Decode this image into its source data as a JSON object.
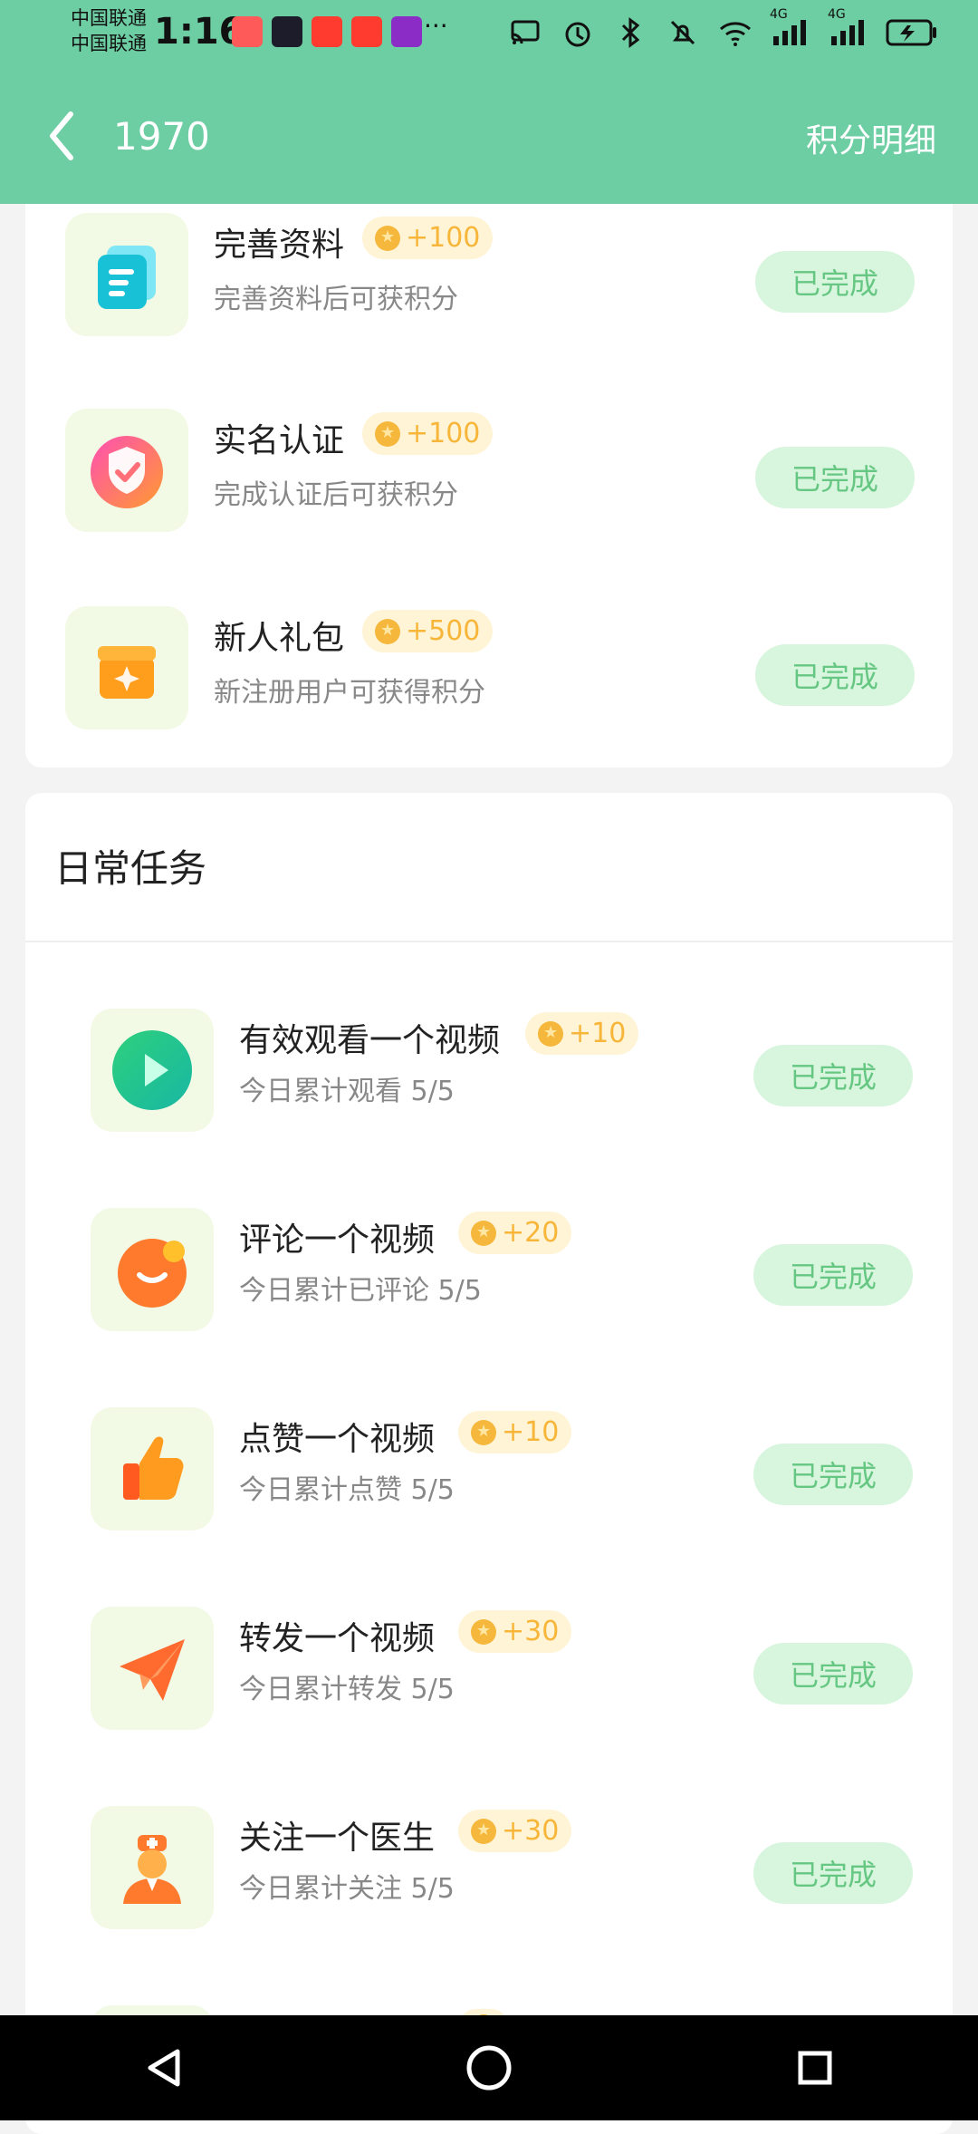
{
  "status": {
    "carrier1": "中国联通",
    "carrier2": "中国联通",
    "time": "1:16",
    "more": "···",
    "net_4g_a": "4G",
    "net_4g_b": "4G"
  },
  "header": {
    "back_icon": "chevron-left-icon",
    "title": "1970",
    "right_link": "积分明细"
  },
  "top_tasks": [
    {
      "name": "完善资料",
      "points": "+100",
      "desc": "完善资料后可获积分",
      "status": "已完成"
    },
    {
      "name": "实名认证",
      "points": "+100",
      "desc": "完成认证后可获积分",
      "status": "已完成"
    },
    {
      "name": "新人礼包",
      "points": "+500",
      "desc": "新注册用户可获得积分",
      "status": "已完成"
    }
  ],
  "daily": {
    "title": "日常任务",
    "tasks": [
      {
        "name": "有效观看一个视频",
        "points": "+10",
        "desc": "今日累计观看 5/5",
        "status": "已完成"
      },
      {
        "name": "评论一个视频",
        "points": "+20",
        "desc": "今日累计已评论 5/5",
        "status": "已完成"
      },
      {
        "name": "点赞一个视频",
        "points": "+10",
        "desc": "今日累计点赞 5/5",
        "status": "已完成"
      },
      {
        "name": "转发一个视频",
        "points": "+30",
        "desc": "今日累计转发 5/5",
        "status": "已完成"
      },
      {
        "name": "关注一个医生",
        "points": "+30",
        "desc": "今日累计关注 5/5",
        "status": "已完成"
      }
    ]
  },
  "colors": {
    "header_green": "#6ecea3",
    "done_bg": "#d8f5de",
    "done_text": "#66c783",
    "points_bg": "#fff4d6",
    "points_text": "#f7b63a"
  }
}
